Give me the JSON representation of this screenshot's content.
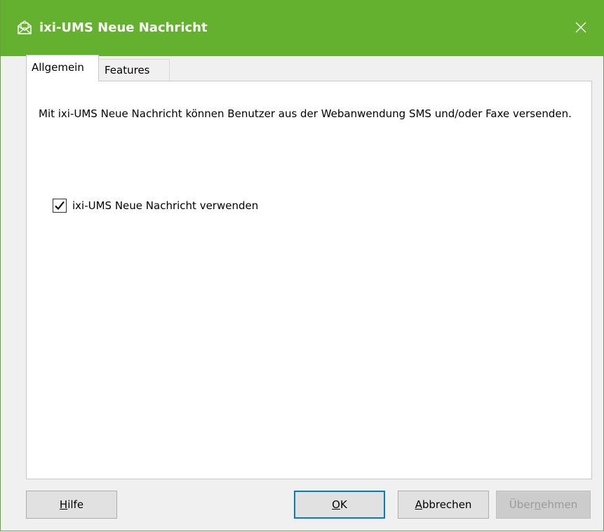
{
  "window": {
    "title": "ixi-UMS Neue Nachricht",
    "title_icon": "envelope-open-icon",
    "close_icon": "close-icon",
    "accent_color": "#64b12f"
  },
  "tabs": [
    {
      "label": "Allgemein",
      "active": true
    },
    {
      "label": "Features",
      "active": false
    }
  ],
  "panel": {
    "description": "Mit ixi-UMS Neue Nachricht können Benutzer aus der Webanwendung SMS und/oder Faxe versenden.",
    "checkbox": {
      "label": "ixi-UMS Neue Nachricht verwenden",
      "checked": true
    }
  },
  "buttons": {
    "help": {
      "mnemonic": "H",
      "rest": "ilfe"
    },
    "ok": {
      "mnemonic": "O",
      "rest": "K"
    },
    "cancel": {
      "mnemonic": "A",
      "rest": "bbrechen"
    },
    "apply": {
      "pre": "Über",
      "mnemonic": "n",
      "rest": "ehmen",
      "enabled": false
    }
  }
}
